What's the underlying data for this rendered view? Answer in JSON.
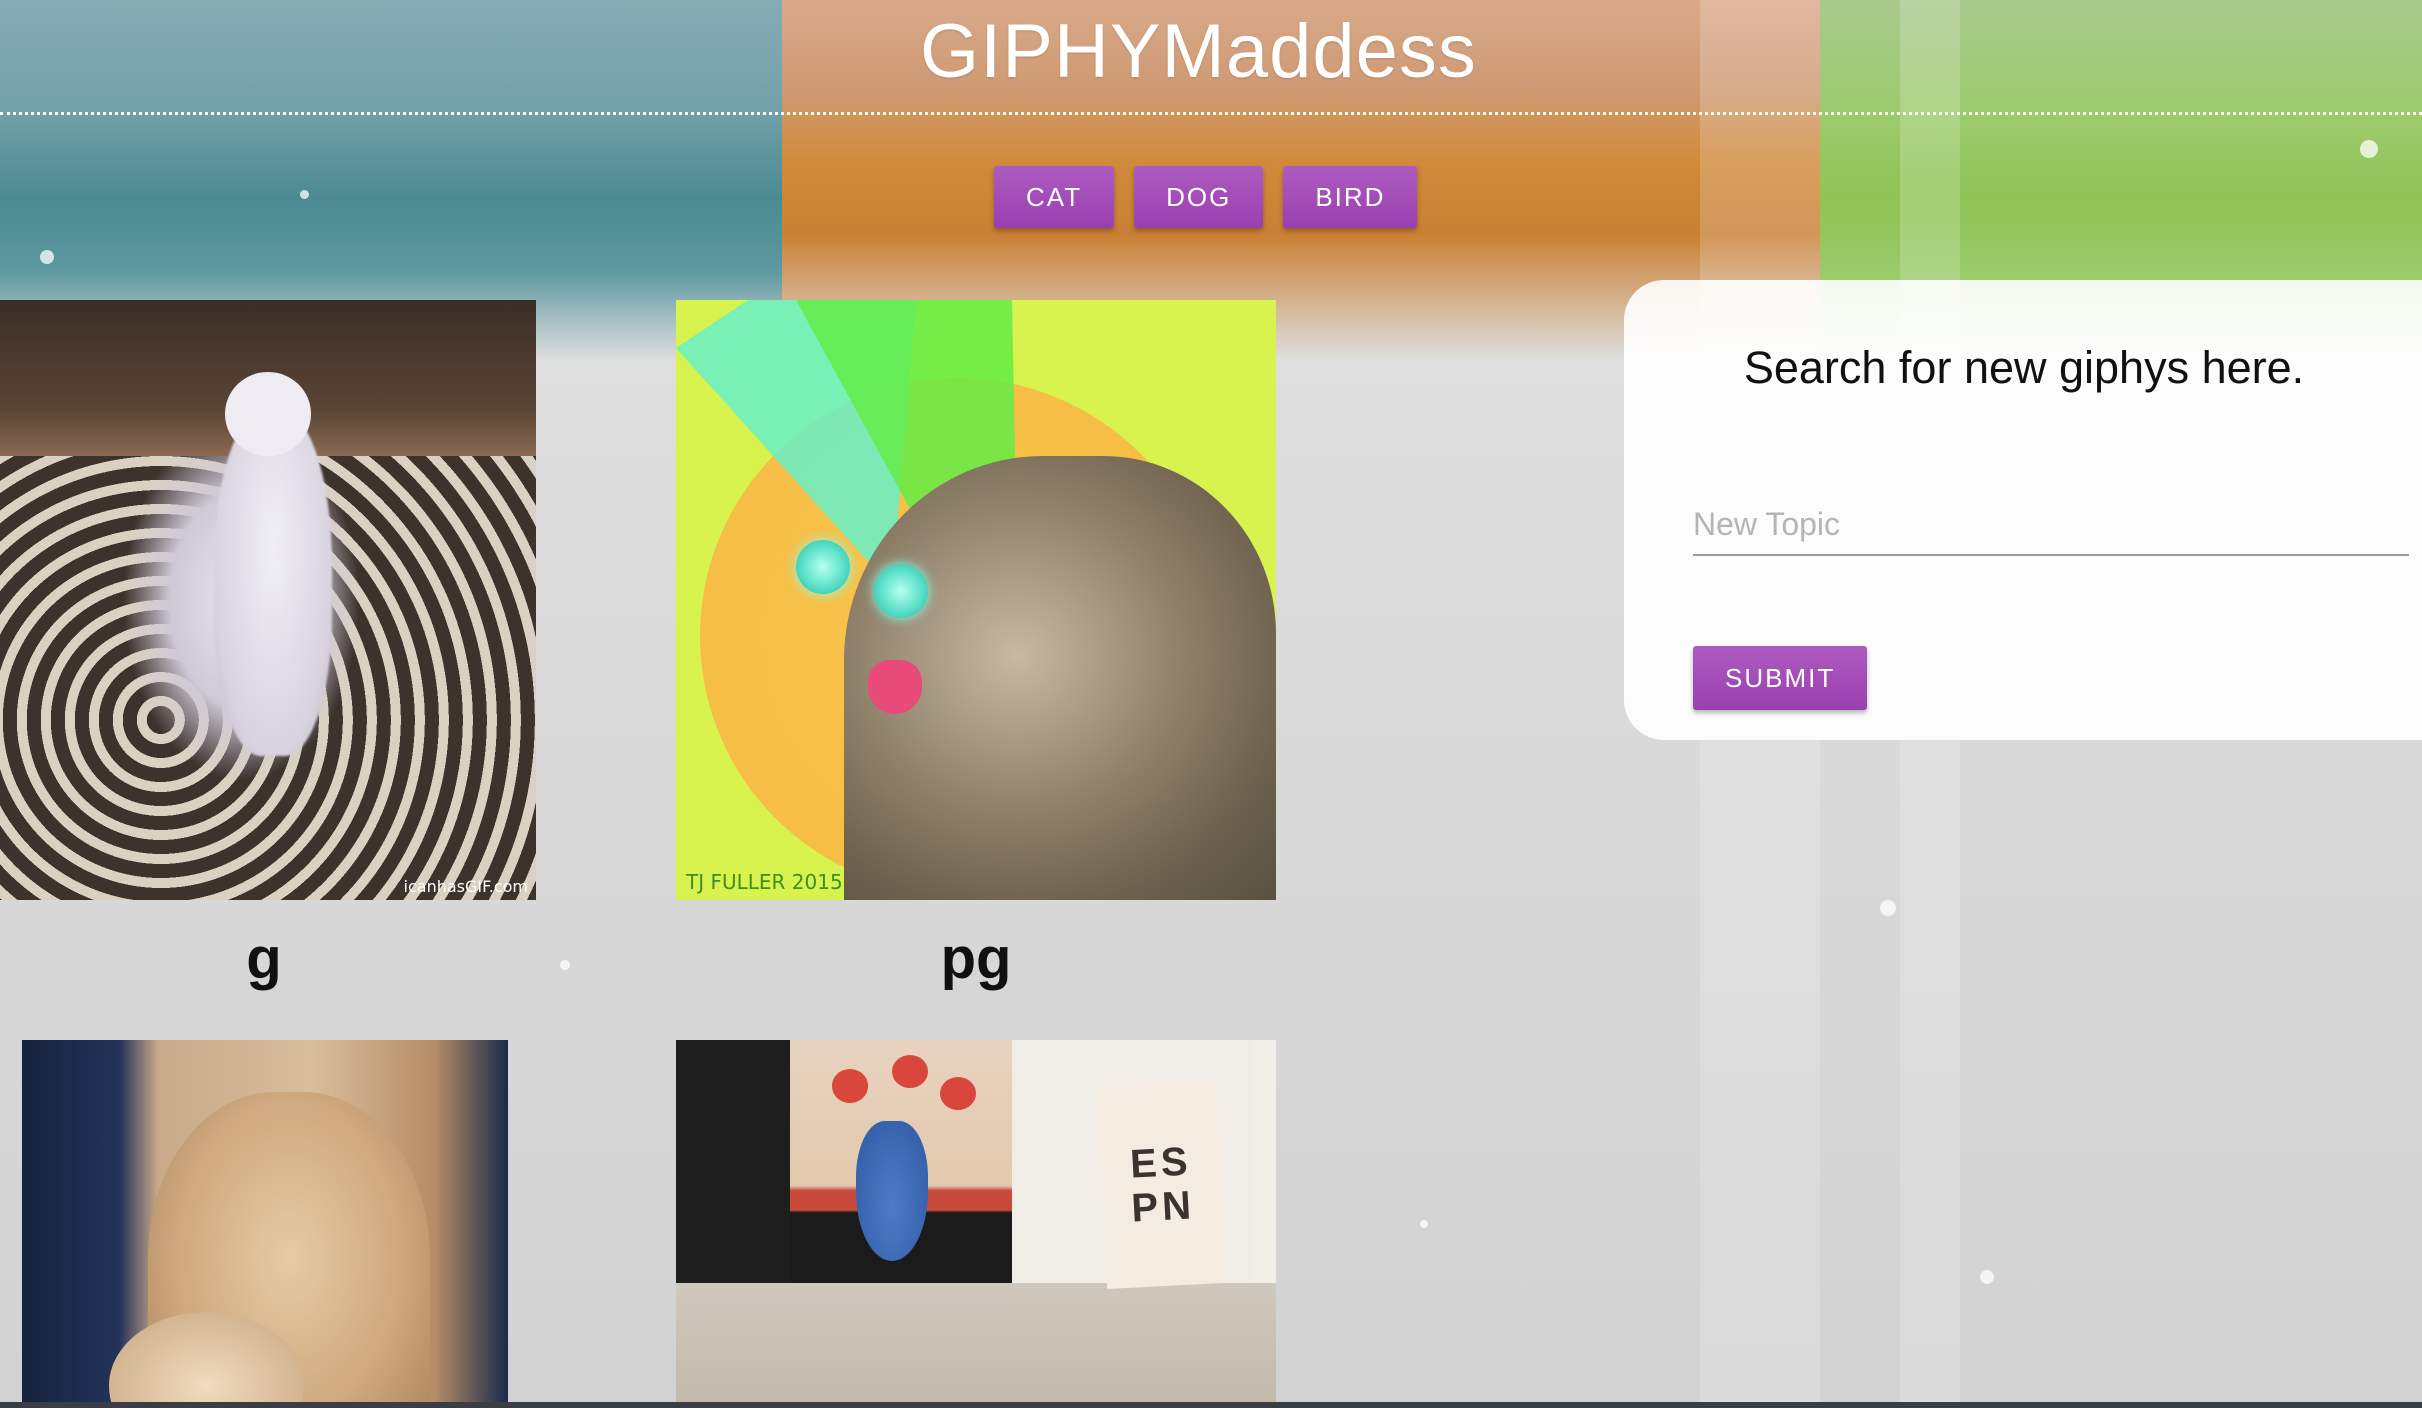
{
  "app": {
    "title": "GIPHYMaddess"
  },
  "topics": [
    "CAT",
    "DOG",
    "BIRD"
  ],
  "gifs": [
    {
      "rating": "g",
      "watermark": "icanhasGIF.com"
    },
    {
      "rating": "pg",
      "watermark": "TJ FULLER 2015"
    },
    {
      "rating": "",
      "watermark": ""
    },
    {
      "rating": "",
      "watermark": "",
      "book_text_top": "ES",
      "book_text_bottom": "PN"
    }
  ],
  "search": {
    "heading": "Search for new giphys here.",
    "placeholder": "New Topic",
    "value": "",
    "submit_label": "SUBMIT"
  },
  "colors": {
    "accent_button": "#a44bba",
    "band_teal": "#5e98a0",
    "band_orange": "#c98034",
    "band_green": "#8fc455"
  }
}
